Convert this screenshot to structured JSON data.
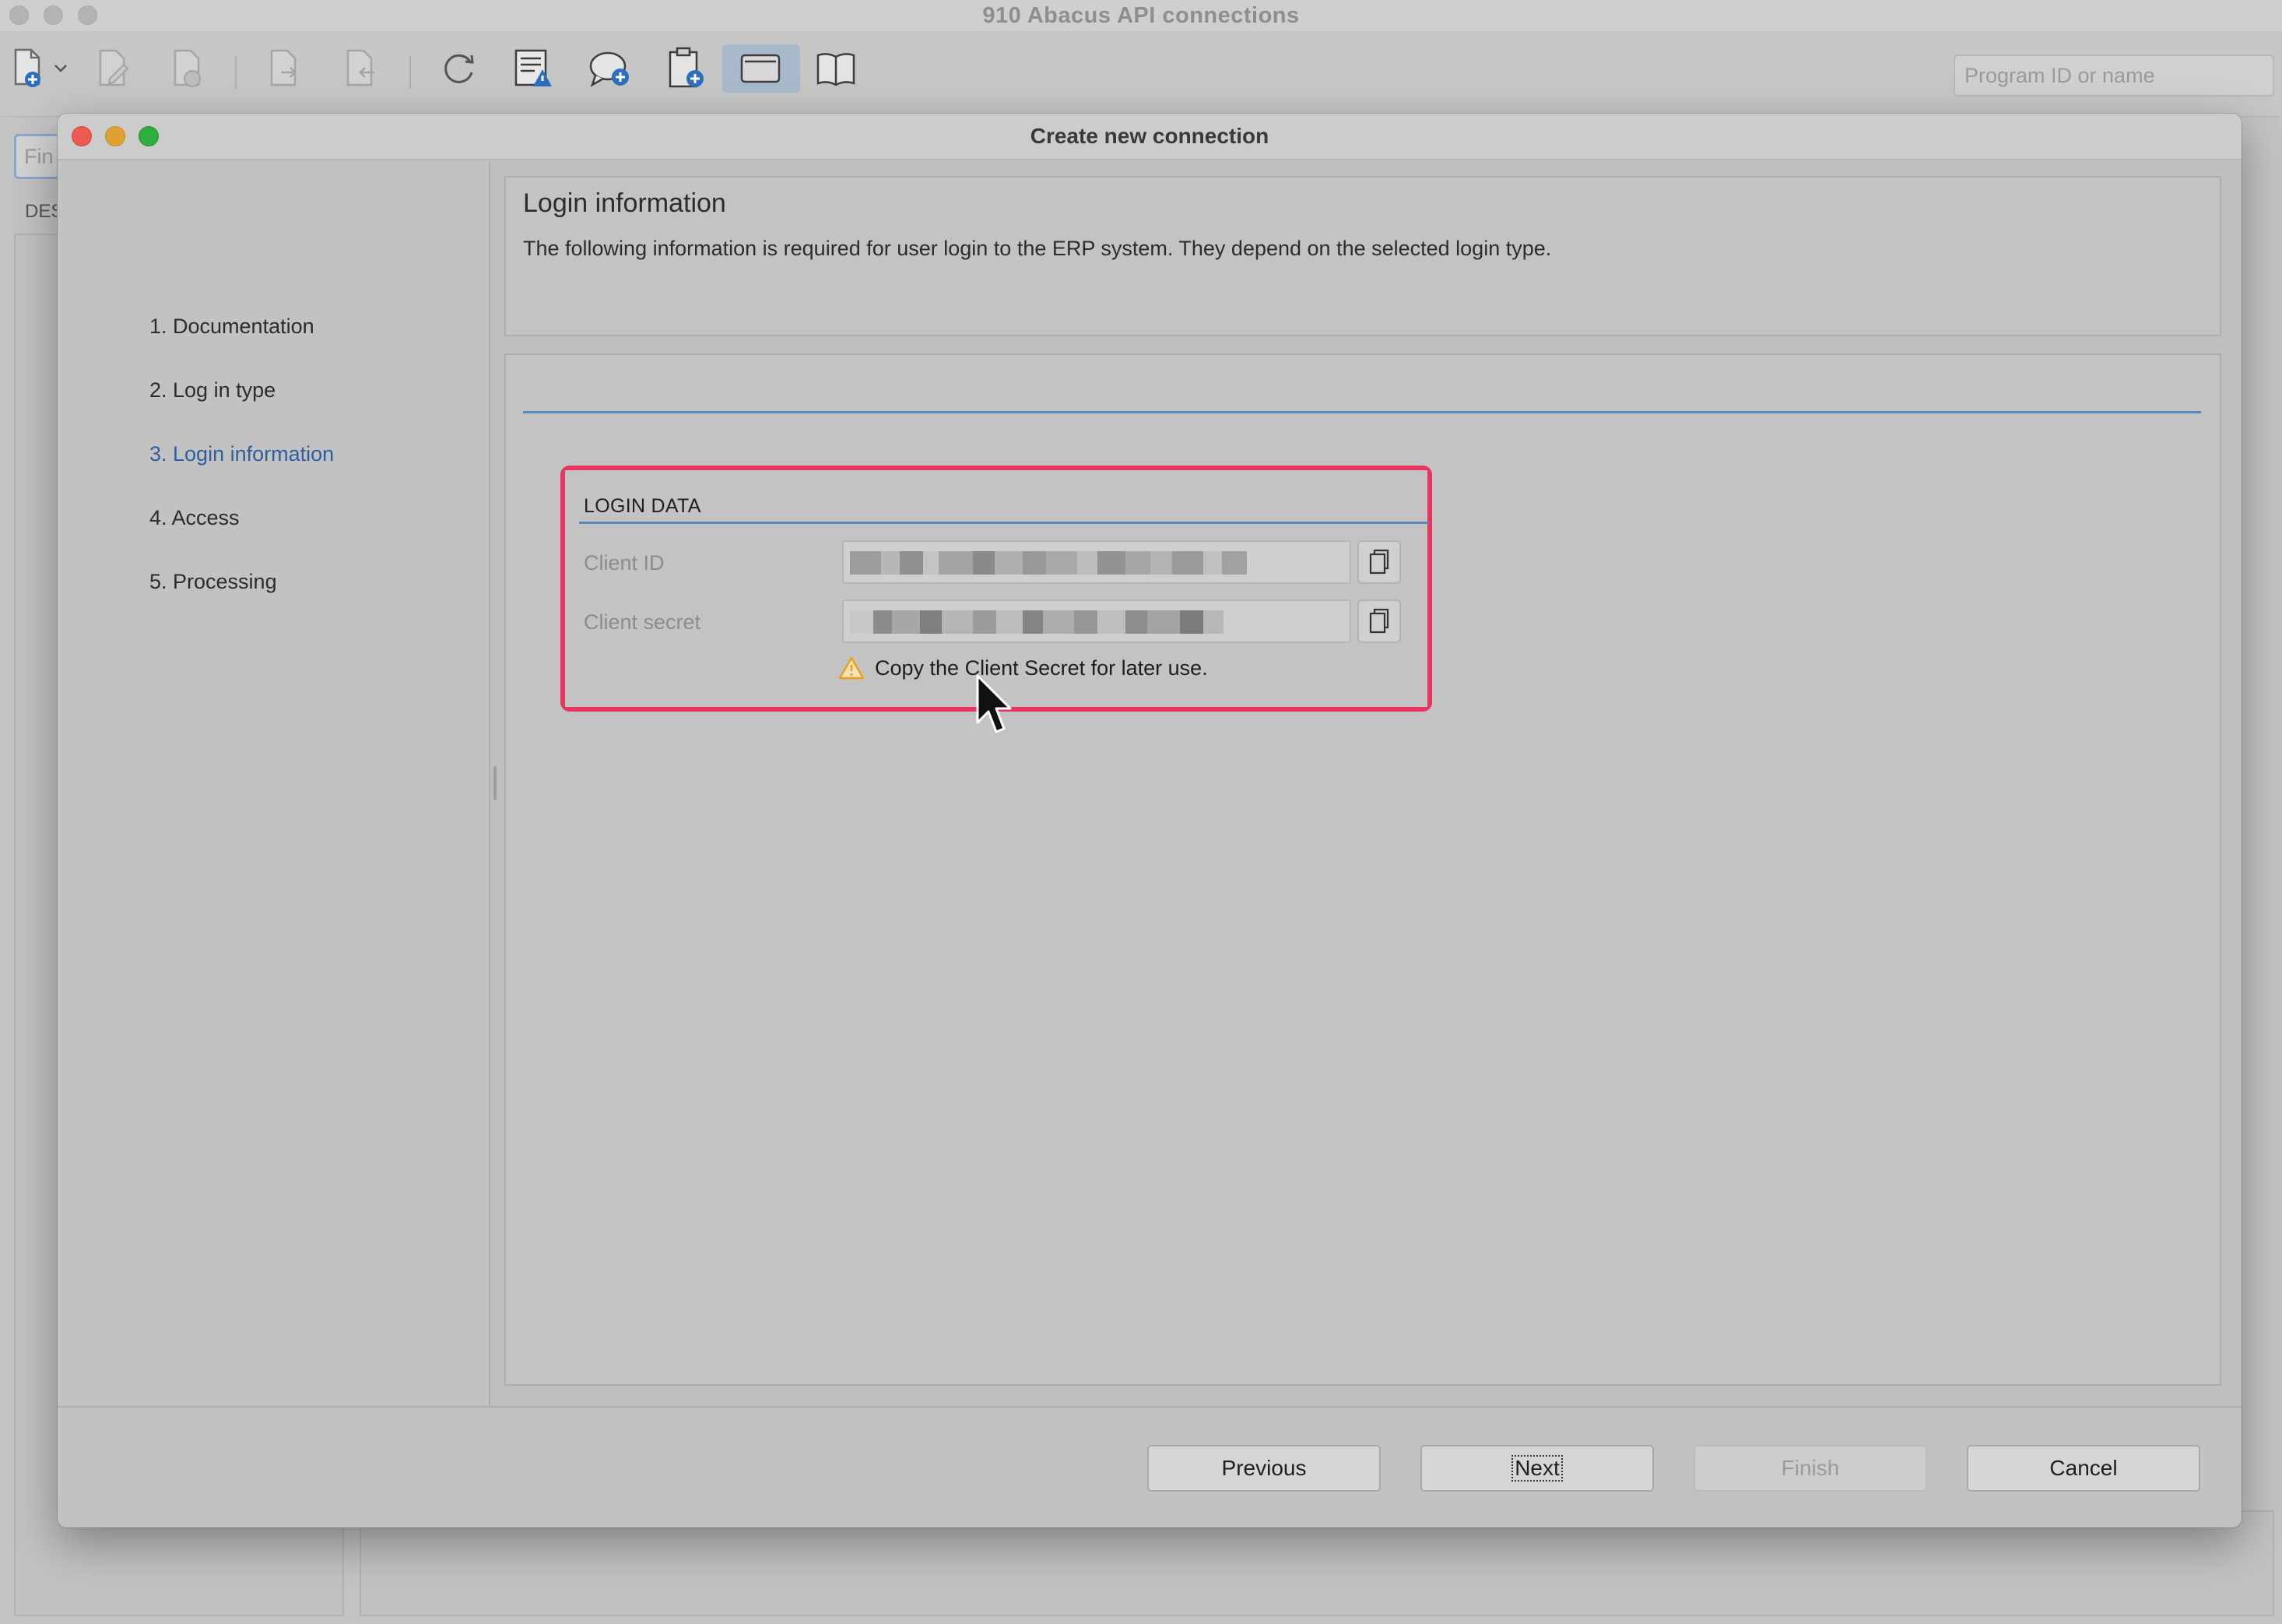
{
  "app": {
    "title": "910 Abacus API connections",
    "search_placeholder": "Program ID or name",
    "left_input_text": "Fin",
    "left_tab_text": "DES"
  },
  "dialog": {
    "title": "Create new connection",
    "steps": [
      {
        "label": "1. Documentation",
        "current": false
      },
      {
        "label": "2. Log in type",
        "current": false
      },
      {
        "label": "3. Login information",
        "current": true
      },
      {
        "label": "4. Access",
        "current": false
      },
      {
        "label": "5. Processing",
        "current": false
      }
    ],
    "header": {
      "title": "Login information",
      "description": "The following information is required for user login to the ERP system. They depend on the selected login type."
    },
    "section": {
      "title": "LOGIN DATA",
      "client_id_label": "Client ID",
      "client_secret_label": "Client secret",
      "warning": "Copy the Client Secret for later use."
    },
    "buttons": {
      "previous": "Previous",
      "next": "Next",
      "finish": "Finish",
      "cancel": "Cancel"
    }
  },
  "colors": {
    "highlight": "#e8355f",
    "current_step": "#2f5f9f",
    "section_line": "#5b87bd",
    "warning_icon": "#e8a21a"
  },
  "icons": {
    "toolbar": [
      "new-document-icon",
      "dropdown-chevron-icon",
      "edit-document-icon",
      "delete-document-icon",
      "export-icon",
      "import-icon",
      "refresh-icon",
      "report-warning-icon",
      "comment-add-icon",
      "clipboard-add-icon",
      "window-icon",
      "book-icon"
    ],
    "copy": "clipboard-copy-icon",
    "warning": "warning-triangle-icon",
    "cursor": "mouse-pointer-icon"
  }
}
